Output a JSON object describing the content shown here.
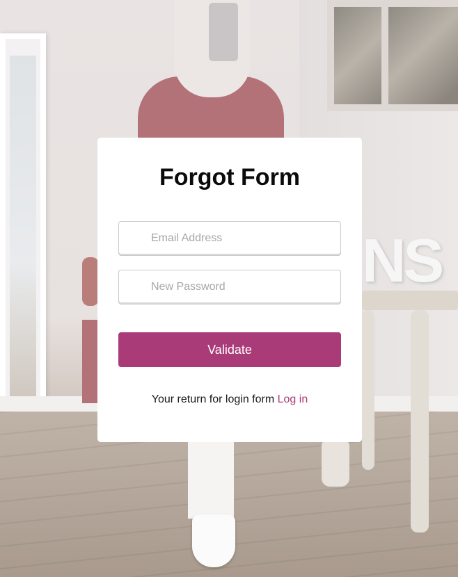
{
  "form": {
    "title": "Forgot Form",
    "email_placeholder": "Email Address",
    "password_placeholder": "New Password",
    "submit_label": "Validate",
    "footer_text": "Your return for login form",
    "login_link": "Log in"
  },
  "colors": {
    "accent": "#a93b78",
    "card_background": "#ffffff",
    "title_text": "#0b0b0b"
  }
}
